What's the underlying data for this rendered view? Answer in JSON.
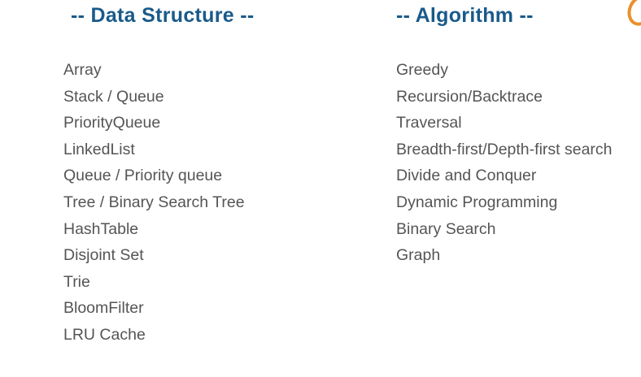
{
  "data_structure": {
    "heading": "-- Data Structure --",
    "items": [
      "Array",
      "Stack / Queue",
      "PriorityQueue",
      "LinkedList",
      "Queue / Priority queue",
      "Tree / Binary Search Tree",
      "HashTable",
      "Disjoint Set",
      "Trie",
      "BloomFilter",
      "LRU Cache"
    ]
  },
  "algorithm": {
    "heading": "-- Algorithm --",
    "items": [
      "Greedy",
      "Recursion/Backtrace",
      "Traversal",
      "Breadth-first/Depth-first search",
      "Divide and Conquer",
      "Dynamic Programming",
      "Binary Search",
      "Graph"
    ]
  },
  "colors": {
    "heading": "#1a5a8a",
    "text": "#555555",
    "accent": "#e8912a"
  }
}
